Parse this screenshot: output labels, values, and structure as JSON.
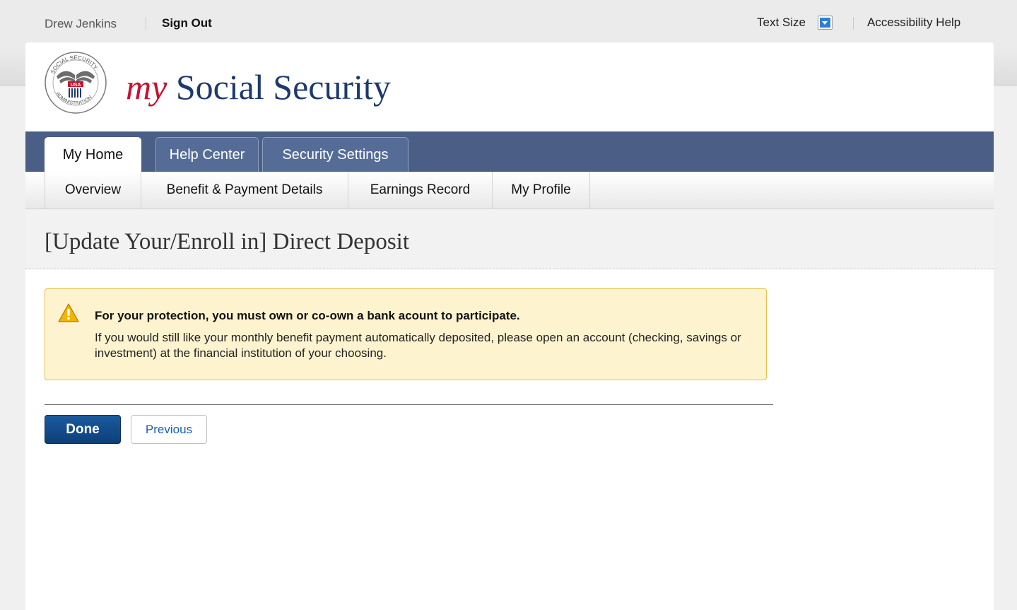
{
  "utility": {
    "user_name": "Drew Jenkins",
    "sign_out": "Sign Out",
    "text_size": "Text Size",
    "text_size_icon": "dropdown-arrow-icon",
    "accessibility_help": "Accessibility Help"
  },
  "header": {
    "brand_my": "my",
    "brand_rest": " Social Security",
    "seal_icon": "ssa-seal-logo",
    "seal_text": "SOCIAL SECURITY ADMINISTRATION USA"
  },
  "tabs": [
    {
      "label": "My Home",
      "active": true
    },
    {
      "label": "Help Center",
      "active": false
    },
    {
      "label": "Security Settings",
      "active": false
    }
  ],
  "subnav": [
    {
      "label": "Overview"
    },
    {
      "label": "Benefit & Payment Details"
    },
    {
      "label": "Earnings Record"
    },
    {
      "label": "My Profile"
    }
  ],
  "page": {
    "title": "[Update Your/Enroll in] Direct Deposit"
  },
  "alert": {
    "icon": "warning-icon",
    "heading": "For your protection, you must own or co-own a bank acount to participate.",
    "body": "If you would still like your monthly benefit payment automatically deposited, please open an account (checking, savings or investment) at the financial institution of your choosing."
  },
  "actions": {
    "done": "Done",
    "previous": "Previous"
  },
  "colors": {
    "tabbar": "#4a5e86",
    "brand_red": "#c8102e",
    "brand_blue": "#1d3a6e",
    "alert_bg": "#fdf3cf",
    "primary_button": "#0d3f79"
  }
}
